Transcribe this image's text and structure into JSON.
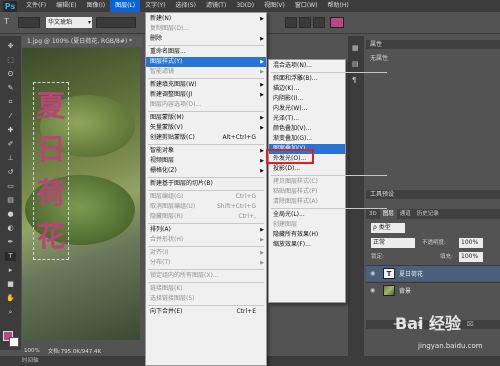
{
  "menubar": {
    "logo": "Ps",
    "items": [
      "文件(F)",
      "编辑(E)",
      "图像(I)",
      "图层(L)",
      "文字(Y)",
      "选择(S)",
      "滤镜(T)",
      "3D(D)",
      "视图(V)",
      "窗口(W)",
      "帮助(H)"
    ],
    "active_index": 3
  },
  "options": {
    "font": "华文琥珀"
  },
  "document": {
    "tab_title": "1.jpg @ 100% (夏日荷花, RGB/8#) *",
    "text_chars": [
      "夏",
      "日",
      "荷",
      "花"
    ],
    "zoom": "100%",
    "doc_info": "文档:795.0K/947.4K",
    "timeline": "时间轴"
  },
  "layer_menu": {
    "rows": [
      {
        "label": "新建(N)",
        "arrow": true
      },
      {
        "label": "复制图层(D)...",
        "disabled": true
      },
      {
        "label": "删除",
        "arrow": true
      },
      {
        "sep": true
      },
      {
        "label": "重命名图层..."
      },
      {
        "label": "图层样式(Y)",
        "arrow": true,
        "highlight": true
      },
      {
        "label": "智能滤镜",
        "arrow": true,
        "disabled": true
      },
      {
        "sep": true
      },
      {
        "label": "新建填充图层(W)",
        "arrow": true
      },
      {
        "label": "新建调整图层(J)",
        "arrow": true
      },
      {
        "label": "图层内容选项(O)...",
        "disabled": true
      },
      {
        "sep": true
      },
      {
        "label": "图层蒙版(M)",
        "arrow": true
      },
      {
        "label": "矢量蒙版(V)",
        "arrow": true
      },
      {
        "label": "创建剪贴蒙版(C)",
        "shortcut": "Alt+Ctrl+G"
      },
      {
        "sep": true
      },
      {
        "label": "智能对象",
        "arrow": true
      },
      {
        "label": "视频图层",
        "arrow": true
      },
      {
        "label": "栅格化(Z)",
        "arrow": true
      },
      {
        "sep": true
      },
      {
        "label": "新建基于图层的切片(B)"
      },
      {
        "sep": true
      },
      {
        "label": "图层编组(G)",
        "shortcut": "Ctrl+G",
        "disabled": true
      },
      {
        "label": "取消图层编组(U)",
        "shortcut": "Shift+Ctrl+G",
        "disabled": true
      },
      {
        "label": "隐藏图层(R)",
        "shortcut": "Ctrl+,",
        "disabled": true
      },
      {
        "sep": true
      },
      {
        "label": "排列(A)",
        "arrow": true
      },
      {
        "label": "合并形状(H)",
        "arrow": true,
        "disabled": true
      },
      {
        "sep": true
      },
      {
        "label": "对齐(I)",
        "arrow": true,
        "disabled": true
      },
      {
        "label": "分布(T)",
        "arrow": true,
        "disabled": true
      },
      {
        "sep": true
      },
      {
        "label": "锁定组内的所有图层(X)...",
        "disabled": true
      },
      {
        "sep": true
      },
      {
        "label": "链接图层(K)",
        "disabled": true
      },
      {
        "label": "选择链接图层(S)",
        "disabled": true
      },
      {
        "sep": true
      },
      {
        "label": "向下合并(E)",
        "shortcut": "Ctrl+E"
      }
    ]
  },
  "style_submenu": {
    "rows": [
      {
        "label": "混合选项(N)..."
      },
      {
        "sep": true
      },
      {
        "label": "斜面和浮雕(B)..."
      },
      {
        "label": "描边(K)..."
      },
      {
        "label": "内阴影(I)..."
      },
      {
        "label": "内发光(W)..."
      },
      {
        "label": "光泽(T)..."
      },
      {
        "label": "颜色叠加(V)..."
      },
      {
        "label": "渐变叠加(G)..."
      },
      {
        "label": "图案叠加(Y)...",
        "highlight": true
      },
      {
        "label": "外发光(O)..."
      },
      {
        "label": "投影(D)..."
      },
      {
        "sep": true
      },
      {
        "label": "拷贝图层样式(C)",
        "disabled": true
      },
      {
        "label": "粘贴图层样式(P)",
        "disabled": true
      },
      {
        "label": "清除图层样式(A)",
        "disabled": true
      },
      {
        "sep": true
      },
      {
        "label": "全局光(L)..."
      },
      {
        "label": "创建图层",
        "disabled": true
      },
      {
        "label": "隐藏所有效果(H)"
      },
      {
        "label": "缩放效果(F)..."
      }
    ]
  },
  "properties": {
    "title": "属性",
    "empty": "无属性"
  },
  "layers_panel": {
    "header": "工具预设",
    "tabs": [
      "3D",
      "图层",
      "通道",
      "历史记录"
    ],
    "kind_label": "ρ 类型",
    "blend": "正常",
    "opacity_label": "不透明度:",
    "opacity": "100%",
    "lock_label": "锁定:",
    "fill_label": "填充:",
    "fill": "100%",
    "layers": [
      {
        "name": "夏日荷花",
        "kind": "text",
        "selected": true
      },
      {
        "name": "背景",
        "kind": "image",
        "selected": false
      }
    ],
    "footer_icons": [
      "link-icon",
      "fx-icon",
      "mask-icon",
      "adjust-icon",
      "folder-icon",
      "new-layer-icon",
      "trash-icon"
    ]
  },
  "watermark": {
    "main": "Bai 经验",
    "sub": "jingyan.baidu.com"
  },
  "colors": {
    "foreground": "#b8487e",
    "background": "#ffffff",
    "highlight": "#2a73d6",
    "redbox": "#e02020"
  }
}
